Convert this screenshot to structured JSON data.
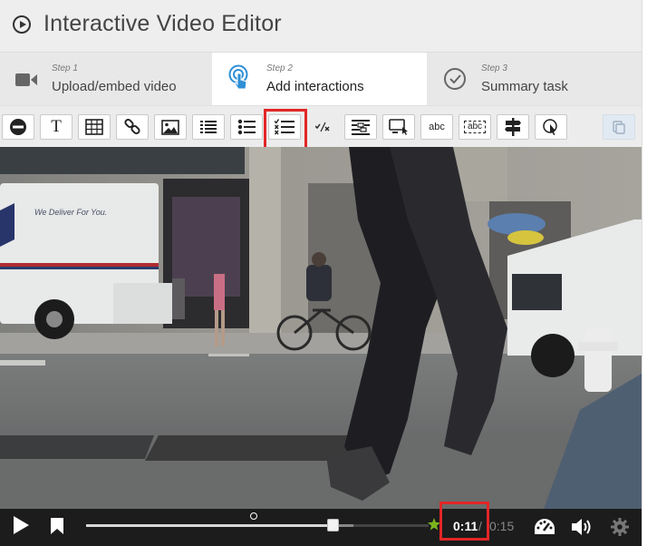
{
  "header": {
    "title": "Interactive Video Editor",
    "icon": "play-circle-icon"
  },
  "steps": [
    {
      "num": "Step 1",
      "label": "Upload/embed video",
      "icon": "video-camera-icon",
      "active": false
    },
    {
      "num": "Step 2",
      "label": "Add interactions",
      "icon": "touch-icon",
      "active": true
    },
    {
      "num": "Step 3",
      "label": "Summary task",
      "icon": "check-circle-icon",
      "active": false
    }
  ],
  "toolbar": {
    "buttons": [
      {
        "name": "label-icon",
        "selected": false
      },
      {
        "name": "text-icon",
        "glyph": "T",
        "selected": false
      },
      {
        "name": "table-icon",
        "selected": false
      },
      {
        "name": "link-icon",
        "selected": false
      },
      {
        "name": "image-icon",
        "selected": false
      },
      {
        "name": "statements-icon",
        "selected": false
      },
      {
        "name": "single-choice-icon",
        "selected": false
      },
      {
        "name": "multiple-choice-icon",
        "selected": true
      },
      {
        "name": "true-false-icon",
        "selected": false
      },
      {
        "name": "fill-in-blanks-icon",
        "selected": false
      },
      {
        "name": "drag-and-drop-icon",
        "selected": false
      },
      {
        "name": "mark-the-words-icon",
        "glyph": "abc",
        "selected": false
      },
      {
        "name": "drag-text-icon",
        "glyph": "abc",
        "selected": false
      },
      {
        "name": "crossroads-icon",
        "selected": false
      },
      {
        "name": "navigation-hotspot-icon",
        "selected": false
      },
      {
        "name": "paste-icon",
        "selected": false,
        "disabled": true
      }
    ]
  },
  "video": {
    "truck_text": "We Deliver For You."
  },
  "controls": {
    "current_time": "0:11",
    "separator": "/",
    "total_time": "0:15",
    "progress_fraction": 0.72,
    "buffered_fraction": 0.78
  }
}
